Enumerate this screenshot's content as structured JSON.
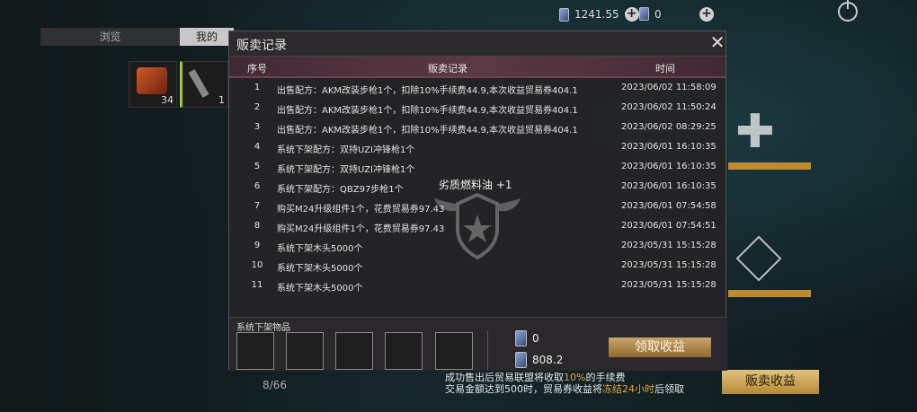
{
  "topbar": {
    "currency1_value": "1241.55",
    "currency2_value": "0"
  },
  "tabs": [
    {
      "label": "浏览"
    },
    {
      "label": "我的"
    }
  ],
  "inventory": [
    {
      "count": "34"
    },
    {
      "count": "1"
    }
  ],
  "modal": {
    "title": "贩卖记录",
    "columns": {
      "index": "序号",
      "record": "贩卖记录",
      "time": "时间"
    },
    "toast": "劣质燃料油 +1",
    "rows": [
      {
        "idx": "1",
        "text": "出售配方：AKM改装步枪1个，扣除10%手续费44.9,本次收益贸易券404.1",
        "time": "2023/06/02 11:58:09"
      },
      {
        "idx": "2",
        "text": "出售配方：AKM改装步枪1个，扣除10%手续费44.9,本次收益贸易券404.1",
        "time": "2023/06/02 11:50:24"
      },
      {
        "idx": "3",
        "text": "出售配方：AKM改装步枪1个，扣除10%手续费44.9,本次收益贸易券404.1",
        "time": "2023/06/02 08:29:25"
      },
      {
        "idx": "4",
        "text": "系统下架配方：双持UZI冲锋枪1个",
        "time": "2023/06/01 16:10:35"
      },
      {
        "idx": "5",
        "text": "系统下架配方：双持UZI冲锋枪1个",
        "time": "2023/06/01 16:10:35"
      },
      {
        "idx": "6",
        "text": "系统下架配方：QBZ97步枪1个",
        "time": "2023/06/01 16:10:35"
      },
      {
        "idx": "7",
        "text": "购买M24升级组件1个，花费贸易券97.43",
        "time": "2023/06/01 07:54:58"
      },
      {
        "idx": "8",
        "text": "购买M24升级组件1个，花费贸易券97.43",
        "time": "2023/06/01 07:54:51"
      },
      {
        "idx": "9",
        "text": "系统下架木头5000个",
        "time": "2023/05/31 15:15:28"
      },
      {
        "idx": "10",
        "text": "系统下架木头5000个",
        "time": "2023/05/31 15:15:28"
      },
      {
        "idx": "11",
        "text": "系统下架木头5000个",
        "time": "2023/05/31 15:15:28"
      }
    ],
    "bottom": {
      "label": "系统下架物品",
      "res1_value": "0",
      "res2_value": "808.2",
      "claim_label": "领取收益"
    }
  },
  "page": {
    "page_num": "8/66",
    "sell_income_label": "贩卖收益",
    "notice_line1_pre": "成功售出后贸易联盟将收取",
    "notice_line1_hl": "10%",
    "notice_line1_post": "的手续费",
    "notice_line2_pre": "交易金额达到500时，贸易券收益将",
    "notice_line2_hl": "冻结24小时",
    "notice_line2_post": "后领取"
  }
}
